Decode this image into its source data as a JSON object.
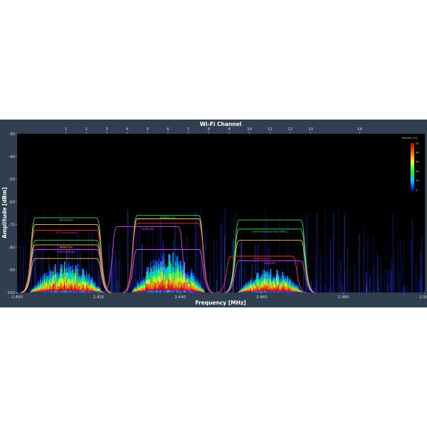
{
  "chart_data": {
    "type": "heatmap",
    "title": "",
    "xlabel": "Frequency [MHz]",
    "ylabel": "Amplitude [dBm]",
    "top_axis_label": "Wi-Fi Channel",
    "xlim": [
      2400,
      2500
    ],
    "ylim": [
      -100,
      -30
    ],
    "x_ticks": [
      {
        "value": 2400,
        "label": "2,400"
      },
      {
        "value": 2420,
        "label": "2,420"
      },
      {
        "value": 2440,
        "label": "2,440"
      },
      {
        "value": 2460,
        "label": "2,460"
      },
      {
        "value": 2480,
        "label": "2,480"
      },
      {
        "value": 2500,
        "label": "2,500"
      }
    ],
    "y_ticks": [
      {
        "value": -30,
        "label": "-30"
      },
      {
        "value": -40,
        "label": "-40"
      },
      {
        "value": -50,
        "label": "-50"
      },
      {
        "value": -60,
        "label": "-60"
      },
      {
        "value": -70,
        "label": "-70"
      },
      {
        "value": -80,
        "label": "-80"
      },
      {
        "value": -90,
        "label": "-90"
      },
      {
        "value": -100,
        "label": "-100"
      }
    ],
    "channels": [
      {
        "label": "1",
        "freq": 2412
      },
      {
        "label": "2",
        "freq": 2417
      },
      {
        "label": "3",
        "freq": 2422
      },
      {
        "label": "4",
        "freq": 2427
      },
      {
        "label": "5",
        "freq": 2432
      },
      {
        "label": "6",
        "freq": 2437
      },
      {
        "label": "7",
        "freq": 2442
      },
      {
        "label": "8",
        "freq": 2447
      },
      {
        "label": "9",
        "freq": 2452
      },
      {
        "label": "10",
        "freq": 2457
      },
      {
        "label": "11",
        "freq": 2462
      },
      {
        "label": "12",
        "freq": 2467
      },
      {
        "label": "13",
        "freq": 2472
      },
      {
        "label": "14",
        "freq": 2484
      }
    ],
    "legend": {
      "title": "Density [%]",
      "placement": "top-right",
      "ticks": [
        {
          "value": 50,
          "label": "50"
        },
        {
          "value": 40,
          "label": "40"
        },
        {
          "value": 30,
          "label": "30"
        },
        {
          "value": 20,
          "label": "20"
        },
        {
          "value": 10,
          "label": "10"
        },
        {
          "value": 0,
          "label": "0"
        }
      ],
      "colors": [
        "#0000ff",
        "#00d0ff",
        "#00ff40",
        "#ffff00",
        "#ff6000",
        "#c00000"
      ]
    },
    "density_clusters": [
      {
        "center": 2412,
        "width": 18,
        "peak_dbm": -86,
        "floor_dbm": -100
      },
      {
        "center": 2437,
        "width": 18,
        "peak_dbm": -82,
        "floor_dbm": -100
      },
      {
        "center": 2462,
        "width": 16,
        "peak_dbm": -89,
        "floor_dbm": -100
      }
    ],
    "networks": [
      {
        "name": "WP-85984",
        "center": 2412,
        "level": -67,
        "color": "#44e060",
        "label_color": "#44e060"
      },
      {
        "name": "",
        "center": 2412,
        "level": -70,
        "color": "#ffcc40",
        "label_color": "#ffcc40"
      },
      {
        "name": "ATT-Duplexmcg",
        "center": 2412,
        "level": -72.5,
        "color": "#ff3030",
        "label_color": "#ff3030"
      },
      {
        "name": "",
        "center": 2412,
        "level": -77,
        "color": "#44e060",
        "label_color": "#44e060"
      },
      {
        "name": "SKNET-90",
        "center": 2412,
        "level": -79,
        "color": "#ffcc40",
        "label_color": "#ffcc40"
      },
      {
        "name": "PRIVATE6598",
        "center": 2412,
        "level": -81,
        "color": "#e040ff",
        "label_color": "#e040ff"
      },
      {
        "name": "",
        "center": 2412,
        "level": -85,
        "color": "#ffcc40",
        "label_color": "#ffcc40"
      },
      {
        "name": "ANBROCA4",
        "center": 2437,
        "level": -66,
        "color": "#44e060",
        "label_color": "#44e060"
      },
      {
        "name": "",
        "center": 2437,
        "level": -67.5,
        "color": "#ffcc40",
        "label_color": "#ffcc40"
      },
      {
        "name": "",
        "center": 2437,
        "level": -69.5,
        "color": "#ff3030",
        "label_color": "#ff3030"
      },
      {
        "name": "ANBROSE",
        "center": 2432,
        "level": -71,
        "color": "#e040ff",
        "label_color": "#e040ff"
      },
      {
        "name": "",
        "center": 2437,
        "level": -81,
        "color": "#e040ff",
        "label_color": "#e040ff"
      },
      {
        "name": "",
        "center": 2462,
        "level": -68,
        "color": "#44e060",
        "label_color": "#44e060"
      },
      {
        "name": "Gold Fantasma Box Office",
        "center": 2462,
        "level": -72,
        "color": "#44e060",
        "label_color": "#44e060"
      },
      {
        "name": "",
        "center": 2462,
        "level": -77,
        "color": "#ffcc40",
        "label_color": "#ffcc40"
      },
      {
        "name": "SOLANDEA-3",
        "center": 2460,
        "level": -84,
        "color": "#ff3030",
        "label_color": "#ff3030"
      },
      {
        "name": "ARKONS",
        "center": 2462,
        "level": -86,
        "color": "#e040ff",
        "label_color": "#e040ff"
      }
    ]
  }
}
